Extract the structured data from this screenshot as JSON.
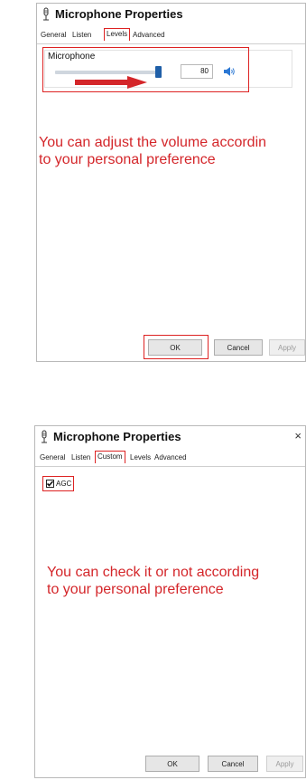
{
  "dialog1": {
    "title": "Microphone Properties",
    "tabs": [
      "General",
      "Listen",
      "Levels",
      "Advanced"
    ],
    "active_tab": "Levels",
    "group_label": "Microphone",
    "volume": {
      "value": "80",
      "level": 0.8
    },
    "note_line1": "You can adjust the volume accordin",
    "note_line2": "to your personal preference",
    "buttons": {
      "ok": "OK",
      "cancel": "Cancel",
      "apply": "Apply"
    }
  },
  "dialog2": {
    "title": "Microphone Properties",
    "close_glyph": "×",
    "tabs": [
      "General",
      "Listen",
      "Custom",
      "Levels",
      "Advanced"
    ],
    "active_tab": "Custom",
    "agc_label": "AGC",
    "agc_checked": true,
    "note_line1": "You can check it or not according",
    "note_line2": "to your personal preference",
    "buttons": {
      "ok": "OK",
      "cancel": "Cancel",
      "apply": "Apply"
    }
  },
  "colors": {
    "annotation_red": "#d4262a",
    "slider_thumb": "#1f5fa8",
    "speaker_blue": "#2c78d4"
  }
}
